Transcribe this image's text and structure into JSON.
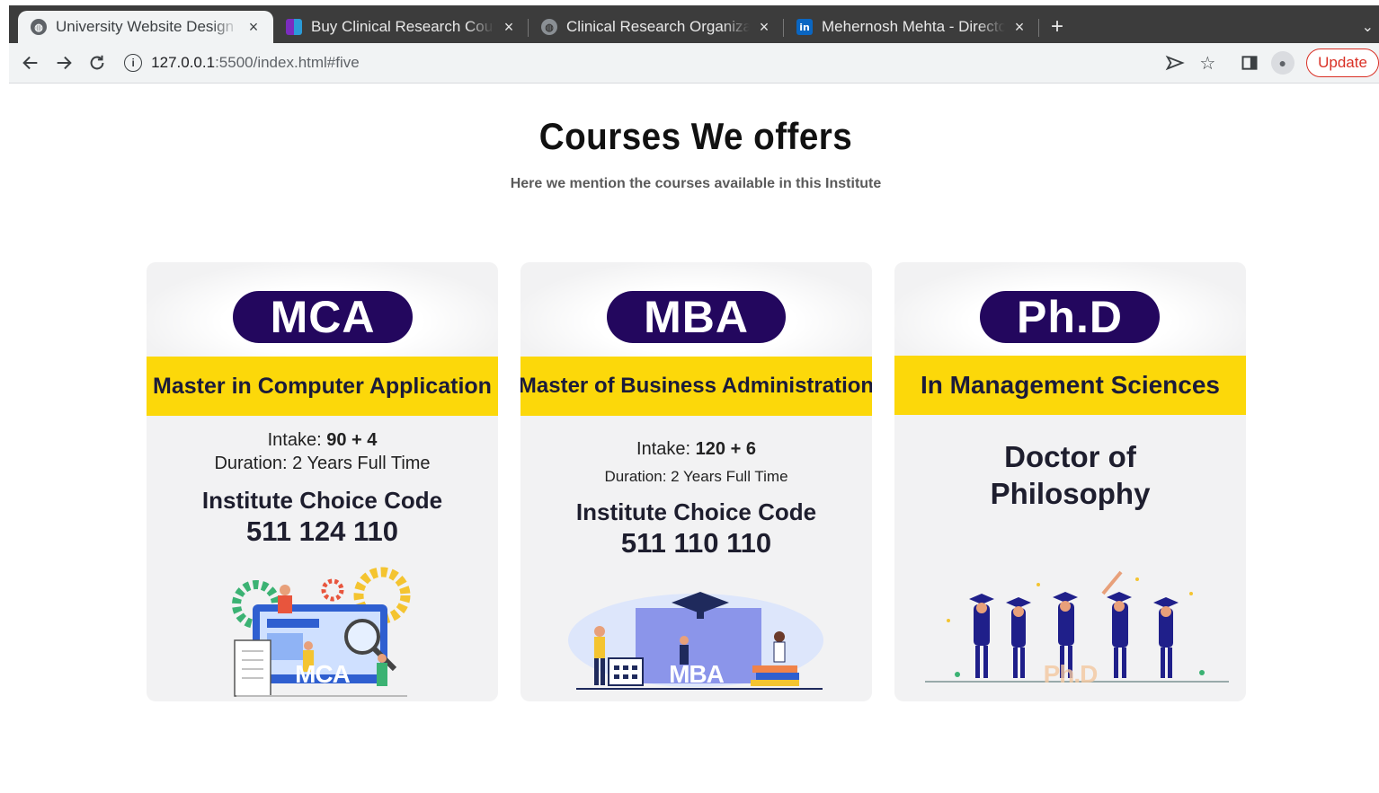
{
  "browser": {
    "tabs": [
      {
        "title": "University Website Design",
        "active": true,
        "icon": "globe-icon"
      },
      {
        "title": "Buy Clinical Research Course",
        "active": false,
        "icon": "brand-logo-icon"
      },
      {
        "title": "Clinical Research Organization",
        "active": false,
        "icon": "globe-icon"
      },
      {
        "title": "Mehernosh Mehta - Director",
        "active": false,
        "icon": "linkedin-icon"
      }
    ],
    "url_host": "127.0.0.1",
    "url_path": ":5500/index.html#five",
    "update_label": "Update"
  },
  "section": {
    "title": "Courses We offers",
    "subtitle": "Here we mention the courses available in this Institute"
  },
  "courses": [
    {
      "badge": "MCA",
      "band": "Master in Computer Application",
      "intake_label": "Intake:",
      "intake_value": "90 + 4",
      "duration": "Duration: 2 Years Full Time",
      "code_label": "Institute Choice Code",
      "code": "511 124 110",
      "illustration_label": "MCA"
    },
    {
      "badge": "MBA",
      "band": "Master of Business Administration",
      "intake_label": "Intake:",
      "intake_value": "120 + 6",
      "duration": "Duration: 2 Years Full Time",
      "code_label": "Institute Choice Code",
      "code": "511 110 110",
      "illustration_label": "MBA"
    },
    {
      "badge": "Ph.D",
      "band": "In Management Sciences",
      "title_line1": "Doctor of",
      "title_line2": "Philosophy",
      "illustration_label": "Ph.D"
    }
  ],
  "colors": {
    "badge_bg": "#23075e",
    "band_bg": "#fcd80a",
    "card_bg": "#f2f2f3",
    "tabstrip_bg": "#3c3c3c",
    "update_red": "#d93025"
  }
}
